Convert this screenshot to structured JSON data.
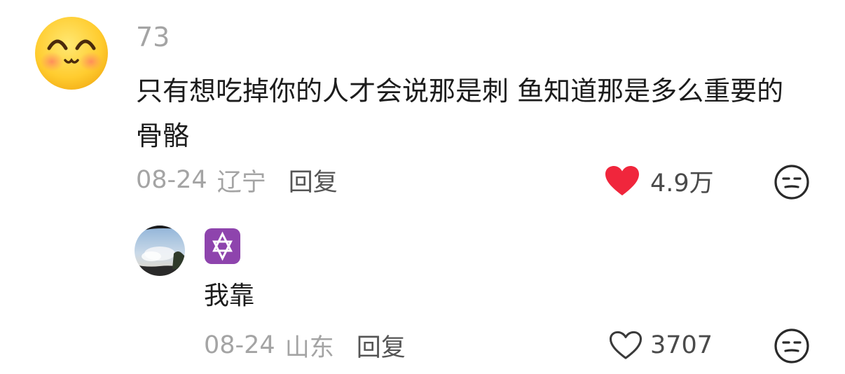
{
  "comment": {
    "username": "73",
    "avatar_icon": "smiling-emoji-icon",
    "text": "只有想吃掉你的人才会说那是刺 鱼知道那是多么重要的骨骼",
    "date": "08-24",
    "location": "辽宁",
    "reply_label": "回复",
    "like_count": "4.9万",
    "liked": true,
    "like_color": "#f0263c"
  },
  "reply": {
    "username_badge": "six-pointed-star-emoji-icon",
    "badge_color": "#8e44ad",
    "text": "我靠",
    "date": "08-24",
    "location": "山东",
    "reply_label": "回复",
    "like_count": "3707",
    "liked": false
  }
}
